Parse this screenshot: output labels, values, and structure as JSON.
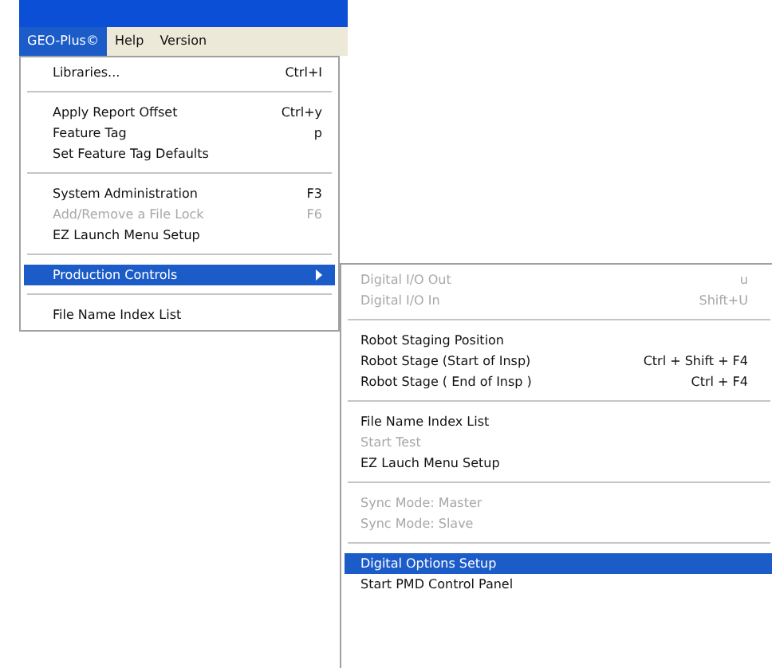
{
  "menubar": [
    {
      "label": "GEO-Plus©",
      "selected": true
    },
    {
      "label": "Help",
      "selected": false
    },
    {
      "label": "Version",
      "selected": false
    }
  ],
  "menu": {
    "items": [
      {
        "kind": "item",
        "label": "Libraries...",
        "shortcut": "Ctrl+I",
        "disabled": false,
        "selected": false
      },
      {
        "kind": "separator"
      },
      {
        "kind": "item",
        "label": "Apply Report Offset",
        "shortcut": "Ctrl+y",
        "disabled": false,
        "selected": false
      },
      {
        "kind": "item",
        "label": "Feature Tag",
        "shortcut": "p",
        "disabled": false,
        "selected": false
      },
      {
        "kind": "item",
        "label": "Set Feature Tag Defaults",
        "disabled": false,
        "selected": false
      },
      {
        "kind": "separator"
      },
      {
        "kind": "item",
        "label": "System Administration",
        "shortcut": "F3",
        "disabled": false,
        "selected": false
      },
      {
        "kind": "item",
        "label": "Add/Remove a File Lock",
        "shortcut": "F6",
        "disabled": true,
        "selected": false
      },
      {
        "kind": "item",
        "label": "EZ Launch Menu Setup",
        "disabled": false,
        "selected": false
      },
      {
        "kind": "separator"
      },
      {
        "kind": "submenu",
        "label": "Production Controls",
        "disabled": false,
        "selected": true
      },
      {
        "kind": "separator"
      },
      {
        "kind": "item",
        "label": "File Name Index List",
        "disabled": false,
        "selected": false
      }
    ]
  },
  "submenu": {
    "items": [
      {
        "kind": "item",
        "label": "Digital I/O Out",
        "shortcut": "u",
        "disabled": true,
        "selected": false
      },
      {
        "kind": "item",
        "label": "Digital I/O In",
        "shortcut": "Shift+U",
        "disabled": true,
        "selected": false
      },
      {
        "kind": "separator"
      },
      {
        "kind": "item",
        "label": "Robot Staging Position",
        "disabled": false,
        "selected": false
      },
      {
        "kind": "item",
        "label": "Robot Stage (Start of Insp)",
        "shortcut": "Ctrl + Shift + F4",
        "disabled": false,
        "selected": false
      },
      {
        "kind": "item",
        "label": "Robot Stage ( End of Insp )",
        "shortcut": "Ctrl + F4",
        "disabled": false,
        "selected": false
      },
      {
        "kind": "separator"
      },
      {
        "kind": "item",
        "label": "File Name Index List",
        "disabled": false,
        "selected": false
      },
      {
        "kind": "item",
        "label": "Start Test",
        "disabled": true,
        "selected": false
      },
      {
        "kind": "item",
        "label": "EZ Lauch Menu Setup",
        "disabled": false,
        "selected": false
      },
      {
        "kind": "separator"
      },
      {
        "kind": "item",
        "label": "Sync Mode: Master",
        "disabled": true,
        "selected": false
      },
      {
        "kind": "item",
        "label": "Sync Mode: Slave",
        "disabled": true,
        "selected": false
      },
      {
        "kind": "separator"
      },
      {
        "kind": "item",
        "label": "Digital Options Setup",
        "disabled": false,
        "selected": true
      },
      {
        "kind": "item",
        "label": "Start PMD Control Panel",
        "disabled": false,
        "selected": false
      }
    ]
  }
}
